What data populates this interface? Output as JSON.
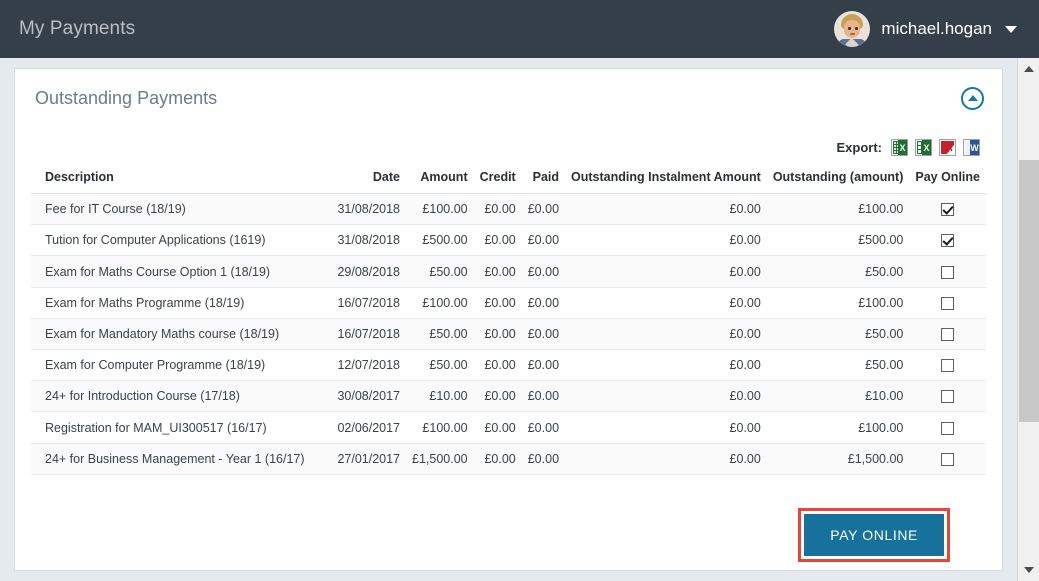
{
  "topbar": {
    "title": "My Payments",
    "username": "michael.hogan",
    "avatar_icon": "user-avatar-photo",
    "caret_icon": "chevron-down-icon"
  },
  "card": {
    "title": "Outstanding Payments",
    "collapse_icon": "chevron-up-circle-icon"
  },
  "export": {
    "label": "Export:",
    "items": [
      {
        "name": "csv-export-icon",
        "letter": "X"
      },
      {
        "name": "excel-export-icon",
        "letter": "X"
      },
      {
        "name": "pdf-export-icon",
        "letter": "A"
      },
      {
        "name": "word-export-icon",
        "letter": "W"
      }
    ]
  },
  "table": {
    "headers": [
      "Description",
      "Date",
      "Amount",
      "Credit",
      "Paid",
      "Outstanding Instalment Amount",
      "Outstanding (amount)",
      "Pay Online"
    ],
    "rows": [
      {
        "description": "Fee for IT Course (18/19)",
        "date": "31/08/2018",
        "amount": "£100.00",
        "credit": "£0.00",
        "paid": "£0.00",
        "outstanding_instalment": "£0.00",
        "outstanding": "£100.00",
        "pay_online": true
      },
      {
        "description": "Tution for Computer Applications (1619)",
        "date": "31/08/2018",
        "amount": "£500.00",
        "credit": "£0.00",
        "paid": "£0.00",
        "outstanding_instalment": "£0.00",
        "outstanding": "£500.00",
        "pay_online": true
      },
      {
        "description": "Exam for Maths Course Option 1 (18/19)",
        "date": "29/08/2018",
        "amount": "£50.00",
        "credit": "£0.00",
        "paid": "£0.00",
        "outstanding_instalment": "£0.00",
        "outstanding": "£50.00",
        "pay_online": false
      },
      {
        "description": "Exam for Maths Programme (18/19)",
        "date": "16/07/2018",
        "amount": "£100.00",
        "credit": "£0.00",
        "paid": "£0.00",
        "outstanding_instalment": "£0.00",
        "outstanding": "£100.00",
        "pay_online": false
      },
      {
        "description": "Exam for Mandatory Maths course (18/19)",
        "date": "16/07/2018",
        "amount": "£50.00",
        "credit": "£0.00",
        "paid": "£0.00",
        "outstanding_instalment": "£0.00",
        "outstanding": "£50.00",
        "pay_online": false
      },
      {
        "description": "Exam for Computer Programme (18/19)",
        "date": "12/07/2018",
        "amount": "£50.00",
        "credit": "£0.00",
        "paid": "£0.00",
        "outstanding_instalment": "£0.00",
        "outstanding": "£50.00",
        "pay_online": false
      },
      {
        "description": "24+  for Introduction Course (17/18)",
        "date": "30/08/2017",
        "amount": "£10.00",
        "credit": "£0.00",
        "paid": "£0.00",
        "outstanding_instalment": "£0.00",
        "outstanding": "£10.00",
        "pay_online": false
      },
      {
        "description": "Registration for MAM_UI300517 (16/17)",
        "date": "02/06/2017",
        "amount": "£100.00",
        "credit": "£0.00",
        "paid": "£0.00",
        "outstanding_instalment": "£0.00",
        "outstanding": "£100.00",
        "pay_online": false
      },
      {
        "description": "24+ for Business Management - Year 1 (16/17)",
        "date": "27/01/2017",
        "amount": "£1,500.00",
        "credit": "£0.00",
        "paid": "£0.00",
        "outstanding_instalment": "£0.00",
        "outstanding": "£1,500.00",
        "pay_online": false
      }
    ]
  },
  "actions": {
    "pay_online_label": "PAY ONLINE",
    "highlight_color": "#e8453c"
  },
  "scrollbar": {
    "up_icon": "scroll-up-arrow-icon",
    "down_icon": "scroll-down-arrow-icon"
  },
  "colors": {
    "header_bg": "#343f49",
    "accent": "#16719c",
    "page_bg": "#e4eaee"
  }
}
